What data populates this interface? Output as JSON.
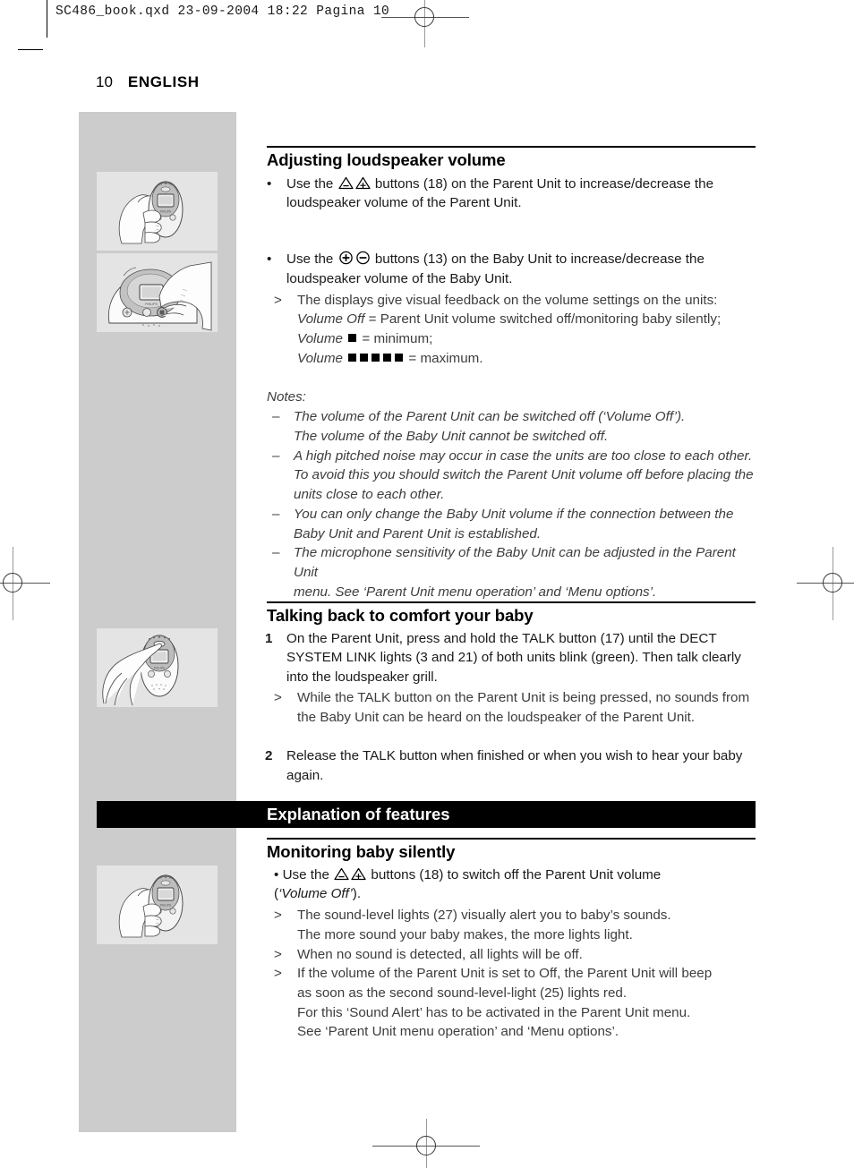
{
  "printmark": {
    "filestamp": "SC486_book.qxd  23-09-2004  18:22  Pagina 10"
  },
  "running_head": {
    "page_number": "10",
    "language": "ENGLISH"
  },
  "sections": {
    "volume": {
      "heading": "Adjusting loudspeaker volume",
      "bullet1": {
        "marker": "•",
        "part_a": "Use the",
        "symbols": "triangle-minus triangle-plus",
        "part_b": "buttons (18) on the Parent Unit to increase/decrease the loudspeaker volume of the Parent Unit."
      },
      "bullet2": {
        "marker": "•",
        "part_a": "Use the",
        "symbols": "circled-plus circled-minus",
        "part_b": "buttons (13) on the Baby Unit to increase/decrease the loudspeaker volume of the Baby Unit."
      },
      "result": {
        "marker": ">",
        "line1": "The displays give visual feedback on the volume settings on the units:",
        "line2_label": "Volume Off",
        "line2_rest": "= Parent Unit volume switched off/monitoring baby silently;",
        "line3_label": "Volume",
        "line3_squares": 1,
        "line3_rest": "= minimum;",
        "line4_label": "Volume",
        "line4_squares": 5,
        "line4_rest": "= maximum."
      },
      "notes_title": "Notes:",
      "notes": [
        {
          "marker": "–",
          "lines": [
            "The volume of the Parent Unit can be switched off (‘Volume Off’).",
            "The volume of the Baby Unit cannot be switched off."
          ]
        },
        {
          "marker": "–",
          "lines": [
            "A high pitched noise may occur in case the units are too close to each other.",
            "To avoid this you should switch the Parent Unit volume off before placing the",
            "units close to each other."
          ]
        },
        {
          "marker": "–",
          "lines": [
            "You can only change the Baby Unit volume if the connection between the",
            "Baby Unit and Parent Unit is established."
          ]
        },
        {
          "marker": "–",
          "lines": [
            "The microphone sensitivity of the Baby Unit can be adjusted in the Parent Unit",
            "menu. See ‘Parent Unit menu operation’ and ‘Menu options’."
          ]
        }
      ]
    },
    "talkback": {
      "heading": "Talking back to comfort your baby",
      "step1": {
        "marker": "1",
        "text": "On the Parent Unit, press and hold the TALK button (17) until the DECT SYSTEM LINK lights (3 and 21) of both units blink (green). Then talk clearly into the loudspeaker grill."
      },
      "step1_result": {
        "marker": ">",
        "text": "While the TALK button on the Parent Unit is being pressed, no sounds from the Baby Unit can be heard on the loudspeaker of the Parent Unit."
      },
      "step2": {
        "marker": "2",
        "text": "Release the TALK button when finished or when you wish to hear your baby again."
      }
    },
    "features": {
      "banner_title": "Explanation of features",
      "heading": "Monitoring baby silently",
      "bullet": {
        "marker": "•",
        "part_a": "Use the",
        "symbols": "triangle-minus triangle-plus",
        "part_b": "buttons (18) to switch off the Parent Unit volume",
        "part_c_quote": "‘Volume Off’"
      },
      "results": [
        {
          "marker": ">",
          "lines": [
            "The sound-level lights (27) visually alert you to baby’s sounds.",
            "The more sound your baby makes, the more lights light."
          ]
        },
        {
          "marker": ">",
          "lines": [
            "When no sound is detected, all lights will be off."
          ]
        },
        {
          "marker": ">",
          "lines": [
            "If the volume of the Parent Unit is set to Off, the Parent Unit will beep",
            "as soon as the second sound-level-light (25) lights red.",
            "For this ‘Sound Alert’ has to be activated in the Parent Unit menu.",
            "See ‘Parent Unit menu operation’ and ‘Menu options’."
          ]
        }
      ]
    }
  },
  "illustrations": [
    {
      "name": "hand-holding-parent-unit",
      "kind": "parent"
    },
    {
      "name": "hand-operating-baby-unit",
      "kind": "baby"
    },
    {
      "name": "finger-pressing-talk-button",
      "kind": "talk"
    },
    {
      "name": "hand-holding-parent-unit-volume-off",
      "kind": "parent"
    }
  ],
  "colors": {
    "gray_column": "#cccccc",
    "illustration_bg": "#e4e4e4",
    "banner_bg": "#000000",
    "banner_text": "#ffffff"
  }
}
